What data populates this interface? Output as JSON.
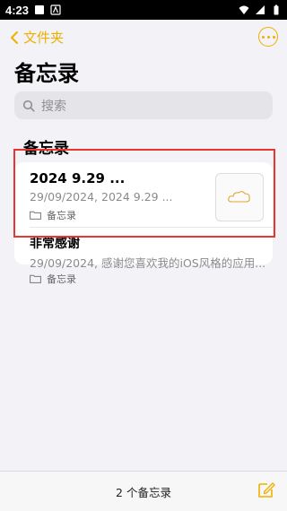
{
  "status_bar": {
    "time": "4:23"
  },
  "topbar": {
    "back_label": "文件夹"
  },
  "page": {
    "title": "备忘录"
  },
  "search": {
    "placeholder": "搜索"
  },
  "section": {
    "title": "备忘录"
  },
  "notes": [
    {
      "title": "2024 9.29 ...",
      "subtitle": "29/09/2024,  2024 9.29 ...",
      "folder": "备忘录",
      "thumbnail": "cloud-sketch-icon"
    },
    {
      "title": "非常感谢",
      "subtitle": "29/09/2024,  感谢您喜欢我的iOS风格的应用...",
      "folder": "备忘录"
    }
  ],
  "footer": {
    "count": "2 个备忘录"
  },
  "colors": {
    "accent": "#f0b000",
    "highlight": "#e8352d",
    "background": "#f2f2f7"
  }
}
